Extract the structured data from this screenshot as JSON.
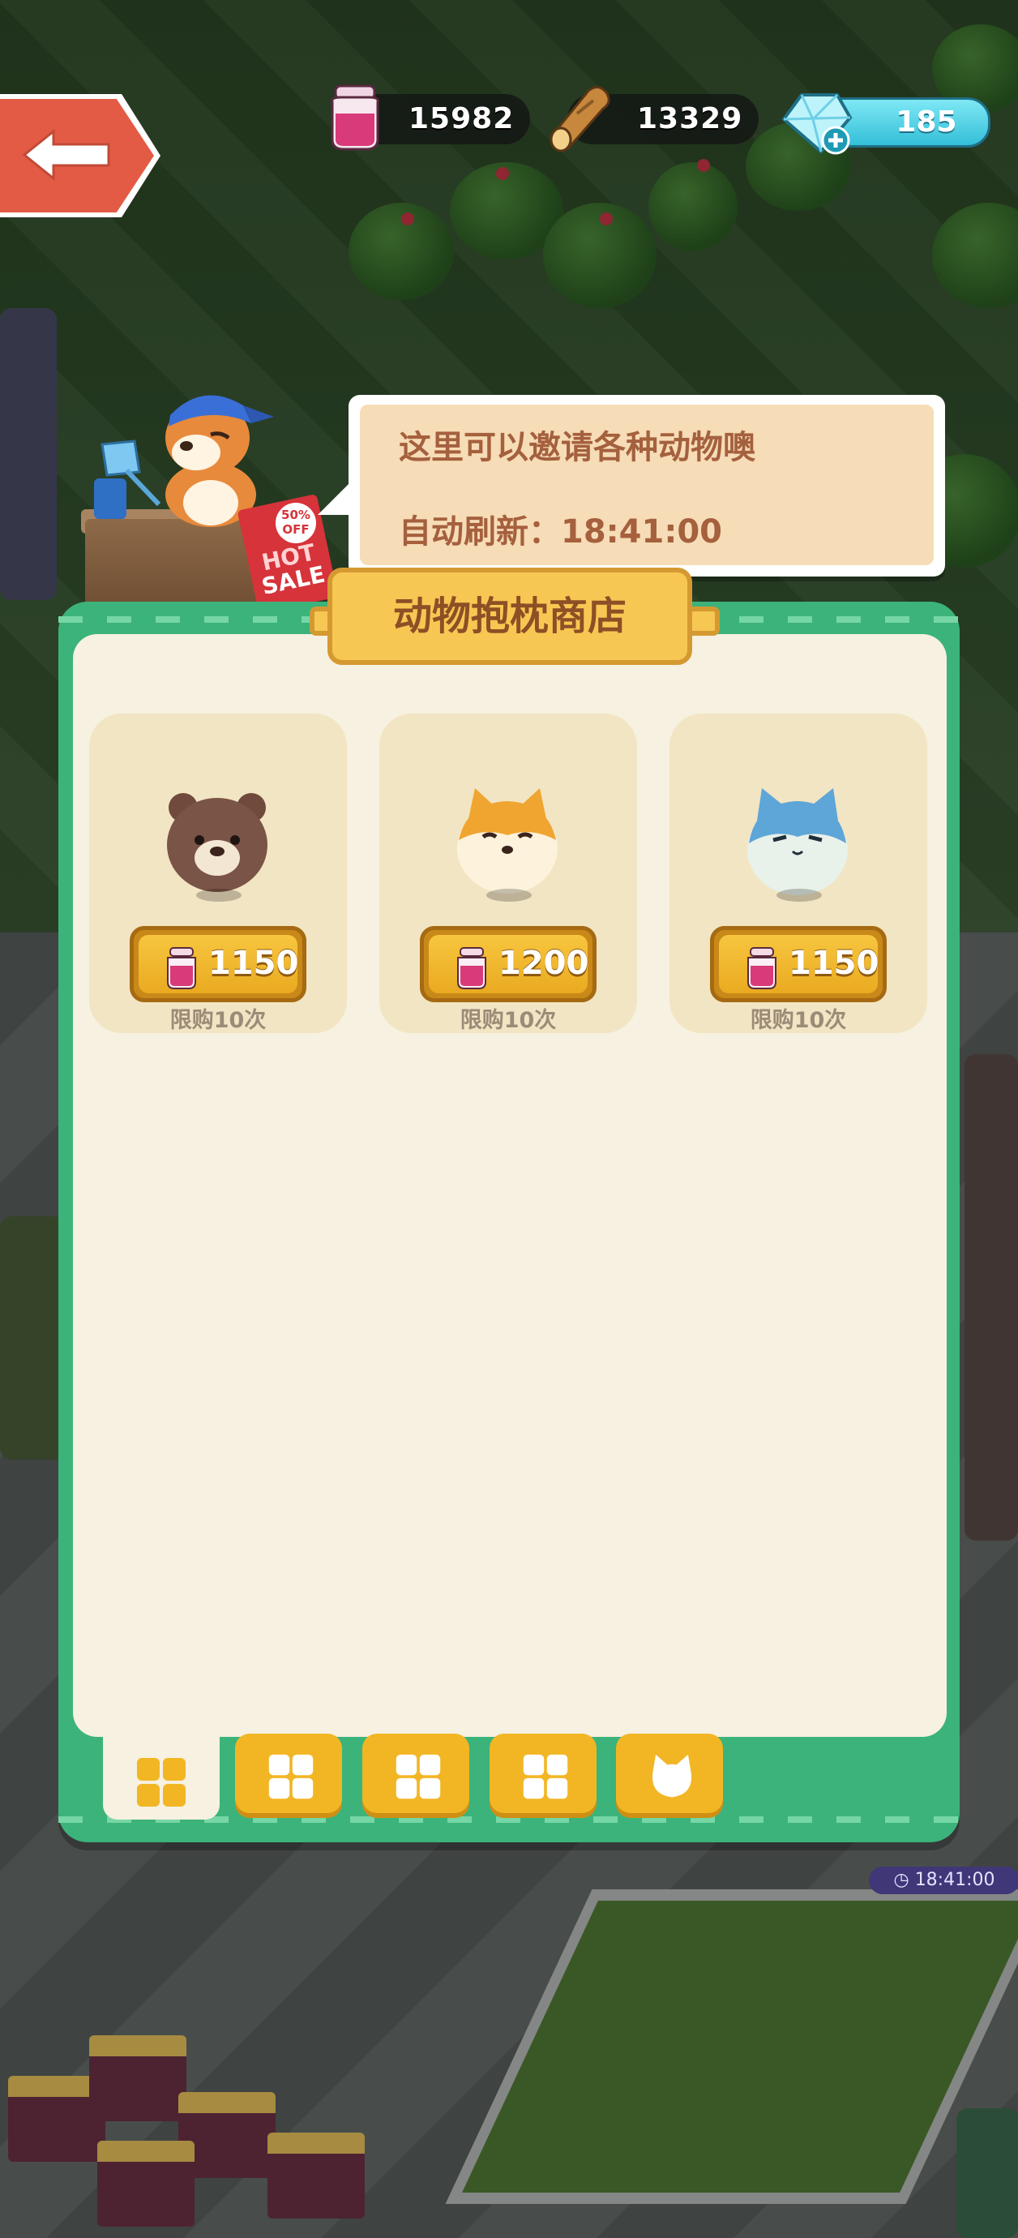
{
  "hud": {
    "jam_amount": "15982",
    "wood_amount": "13329",
    "gem_amount": "185"
  },
  "shopkeeper": {
    "sign_line1": "50%",
    "sign_line2": "OFF",
    "sign_hot": "HOT",
    "sign_sale": "SALE",
    "speech_line1": "这里可以邀请各种动物噢",
    "speech_line2": "自动刷新：18:41:00"
  },
  "shop": {
    "title": "动物抱枕商店",
    "items": [
      {
        "pet": "bear-pillow-icon",
        "price": "1150",
        "limit": "限购10次"
      },
      {
        "pet": "shiba-pillow-icon",
        "price": "1200",
        "limit": "限购10次"
      },
      {
        "pet": "blue-cat-pillow-icon",
        "price": "1150",
        "limit": "限购10次"
      }
    ],
    "tabs": [
      "grid-icon",
      "grid-icon",
      "grid-icon",
      "grid-icon",
      "cat-icon"
    ]
  },
  "timer_chip": "18:41:00",
  "colors": {
    "panel_green": "#3cb37a",
    "panel_cream": "#f6f1e0",
    "gold": "#f7c753",
    "brown_text": "#8d4f25",
    "price_gold": "#e9aa20"
  }
}
